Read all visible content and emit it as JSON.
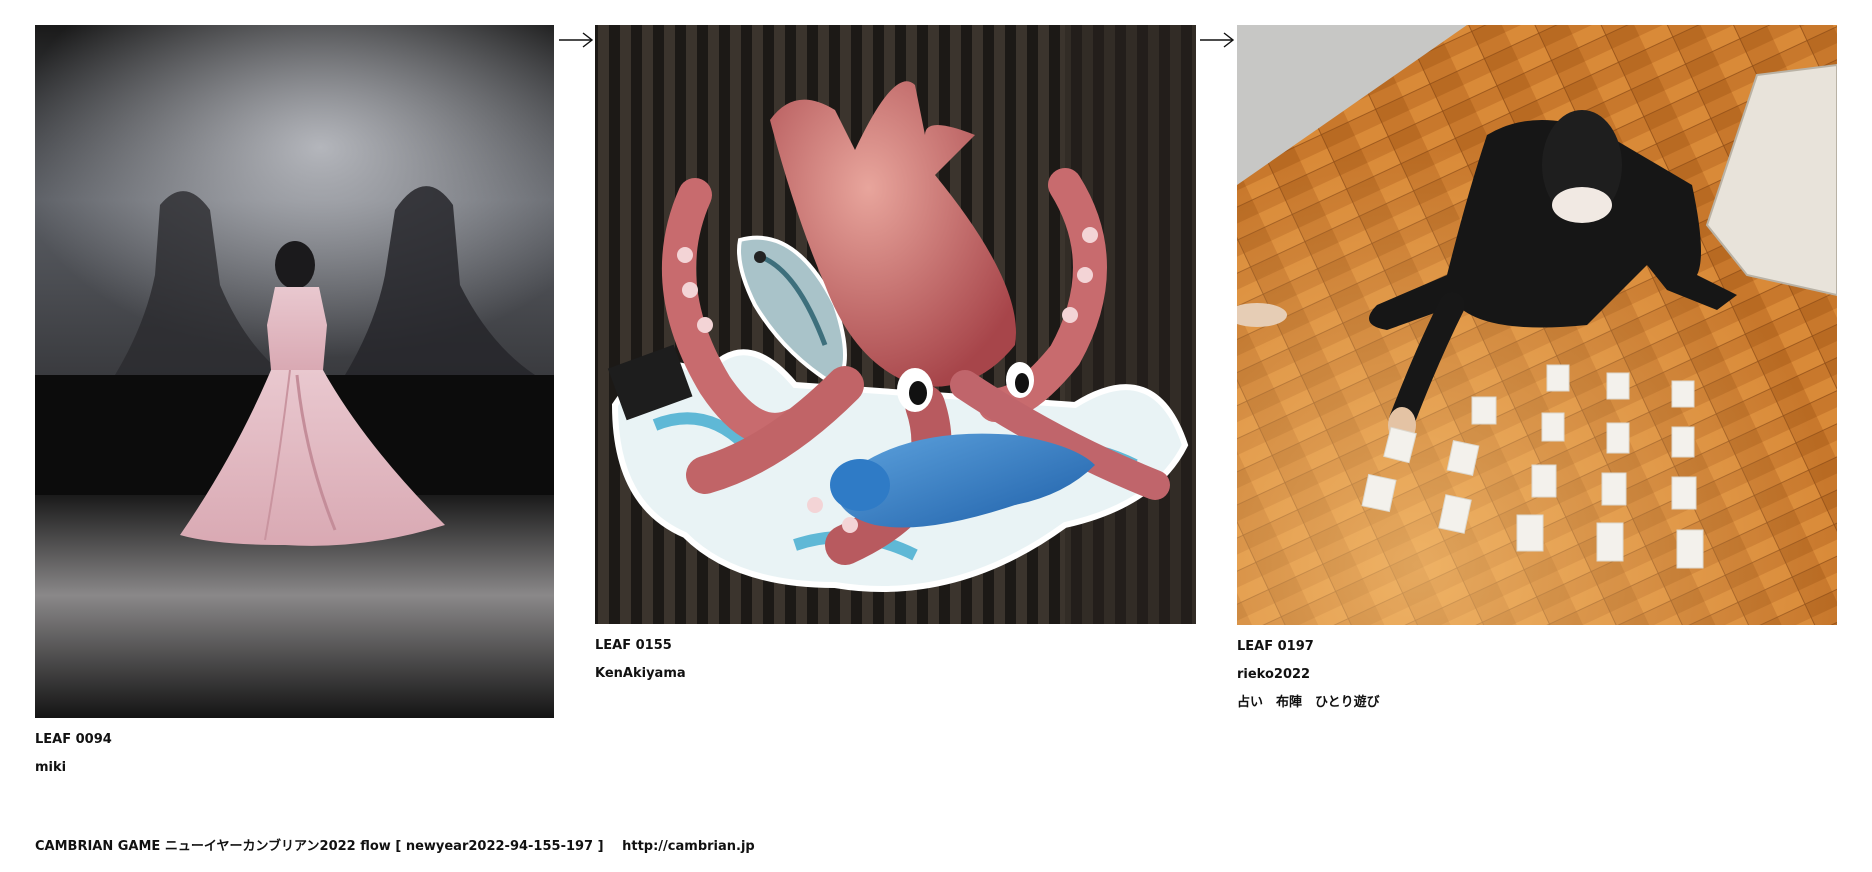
{
  "leaves": [
    {
      "id": "LEAF 0094",
      "author": "miki",
      "note": "",
      "image_icon": "photo-pink-gown-on-stage"
    },
    {
      "id": "LEAF 0155",
      "author": "KenAkiyama",
      "note": "",
      "image_icon": "photo-squid-sculpture"
    },
    {
      "id": "LEAF 0197",
      "author": "rieko2022",
      "note": "占い　布陣　ひとり遊び",
      "image_icon": "photo-card-spread-on-floor"
    }
  ],
  "arrows": [
    "→",
    "→"
  ],
  "footer": {
    "title": "CAMBRIAN GAME ニューイヤーカンブリアン2022 flow [ newyear2022-94-155-197 ]",
    "url": "http://cambrian.jp"
  },
  "colors": {
    "background": "#ffffff",
    "text": "#111111"
  }
}
